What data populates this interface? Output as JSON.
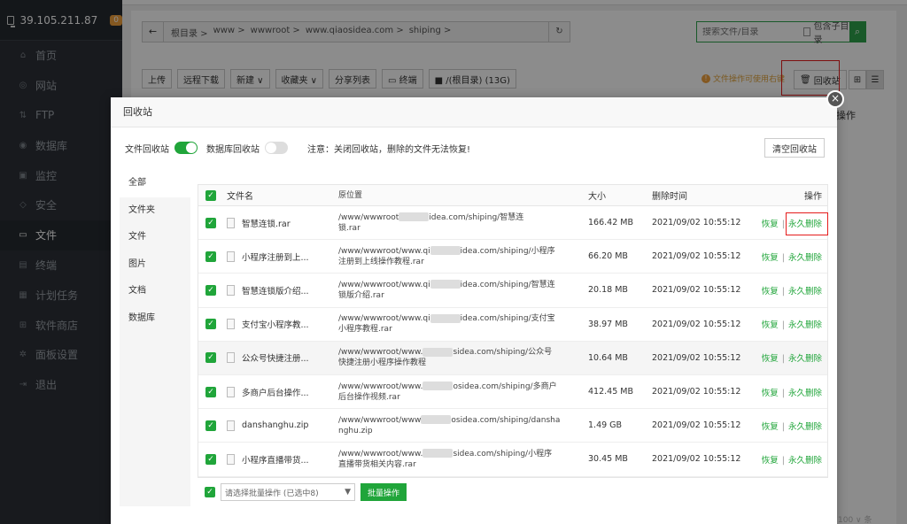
{
  "sidebar": {
    "server_ip": "39.105.211.87",
    "badge": "0",
    "items": [
      {
        "label": "首页",
        "icon": "home-icon",
        "glyph": "⌂"
      },
      {
        "label": "网站",
        "icon": "globe-icon",
        "glyph": "◎"
      },
      {
        "label": "FTP",
        "icon": "ftp-icon",
        "glyph": "⇅"
      },
      {
        "label": "数据库",
        "icon": "database-icon",
        "glyph": "◉"
      },
      {
        "label": "监控",
        "icon": "monitor-icon",
        "glyph": "▣"
      },
      {
        "label": "安全",
        "icon": "shield-icon",
        "glyph": "◇"
      },
      {
        "label": "文件",
        "icon": "folder-icon",
        "glyph": "▭"
      },
      {
        "label": "终端",
        "icon": "terminal-icon",
        "glyph": "▤"
      },
      {
        "label": "计划任务",
        "icon": "calendar-icon",
        "glyph": "▦"
      },
      {
        "label": "软件商店",
        "icon": "grid-icon",
        "glyph": "⊞"
      },
      {
        "label": "面板设置",
        "icon": "gear-icon",
        "glyph": "✲"
      },
      {
        "label": "退出",
        "icon": "logout-icon",
        "glyph": "⇥"
      }
    ]
  },
  "address": {
    "back_glyph": "←",
    "crumbs": [
      "根目录 >",
      "www >",
      "wwwroot >",
      "www.qiaosidea.com >",
      "shiping >"
    ],
    "refresh_glyph": "↻"
  },
  "search": {
    "placeholder": "搜索文件/目录",
    "subdir_label": "包含子目录",
    "btn_glyph": "⌕"
  },
  "toolbar": {
    "buttons": [
      "上传",
      "远程下载",
      "新建 ∨",
      "收藏夹 ∨",
      "分享列表",
      "▭ 终端",
      "■ /(根目录) (13G)"
    ]
  },
  "notice": {
    "text": "文件操作可使用右键",
    "glyph": "!"
  },
  "recycle_button": "回收站",
  "bg_ops_header": "操作",
  "modal": {
    "title": "回收站",
    "file_recycle_label": "文件回收站",
    "db_recycle_label": "数据库回收站",
    "warning": "注意：关闭回收站，删除的文件无法恢复!",
    "clear_button": "清空回收站",
    "close_glyph": "×",
    "categories": [
      "全部",
      "文件夹",
      "文件",
      "图片",
      "文档",
      "数据库"
    ],
    "headers": {
      "name": "文件名",
      "path": "原位置",
      "size": "大小",
      "time": "删除时间",
      "ops": "操作"
    },
    "restore_label": "恢复",
    "delete_label": "永久删除",
    "rows": [
      {
        "name": "智慧连锁.rar",
        "path1a": "/www/wwwroot",
        "path1b": "idea.com/shiping/智慧连",
        "path2": "锁.rar",
        "size": "166.42 MB",
        "time": "2021/09/02 10:55:12"
      },
      {
        "name": "小程序注册到上...",
        "path1a": "/www/wwwroot/www.qi",
        "path1b": "idea.com/shiping/小程序",
        "path2": "注册到上线操作教程.rar",
        "size": "66.20 MB",
        "time": "2021/09/02 10:55:12"
      },
      {
        "name": "智慧连锁版介绍...",
        "path1a": "/www/wwwroot/www.qi",
        "path1b": "idea.com/shiping/智慧连",
        "path2": "锁版介绍.rar",
        "size": "20.18 MB",
        "time": "2021/09/02 10:55:12"
      },
      {
        "name": "支付宝小程序教...",
        "path1a": "/www/wwwroot/www.qi",
        "path1b": "idea.com/shiping/支付宝",
        "path2": "小程序教程.rar",
        "size": "38.97 MB",
        "time": "2021/09/02 10:55:12"
      },
      {
        "name": "公众号快捷注册...",
        "path1a": "/www/wwwroot/www.",
        "path1b": "sidea.com/shiping/公众号",
        "path2": "快捷注册小程序操作教程",
        "size": "10.64 MB",
        "time": "2021/09/02 10:55:12"
      },
      {
        "name": "多商户后台操作...",
        "path1a": "/www/wwwroot/www.",
        "path1b": "osidea.com/shiping/多商户",
        "path2": "后台操作视频.rar",
        "size": "412.45 MB",
        "time": "2021/09/02 10:55:12"
      },
      {
        "name": "danshanghu.zip",
        "path1a": "/www/wwwroot/www",
        "path1b": "osidea.com/shiping/dansha",
        "path2": "nghu.zip",
        "size": "1.49 GB",
        "time": "2021/09/02 10:55:12"
      },
      {
        "name": "小程序直播带货...",
        "path1a": "/www/wwwroot/www.",
        "path1b": "sidea.com/shiping/小程序",
        "path2": "直播带货相关内容.rar",
        "size": "30.45 MB",
        "time": "2021/09/02 10:55:12"
      }
    ],
    "batch_placeholder": "请选择批量操作 (已选中8)",
    "batch_button": "批量操作"
  },
  "pager": "100 ∨ 条",
  "colors": {
    "accent": "#20a53a",
    "highlight": "#e51c1c",
    "sidebar_bg": "#2c3138"
  }
}
